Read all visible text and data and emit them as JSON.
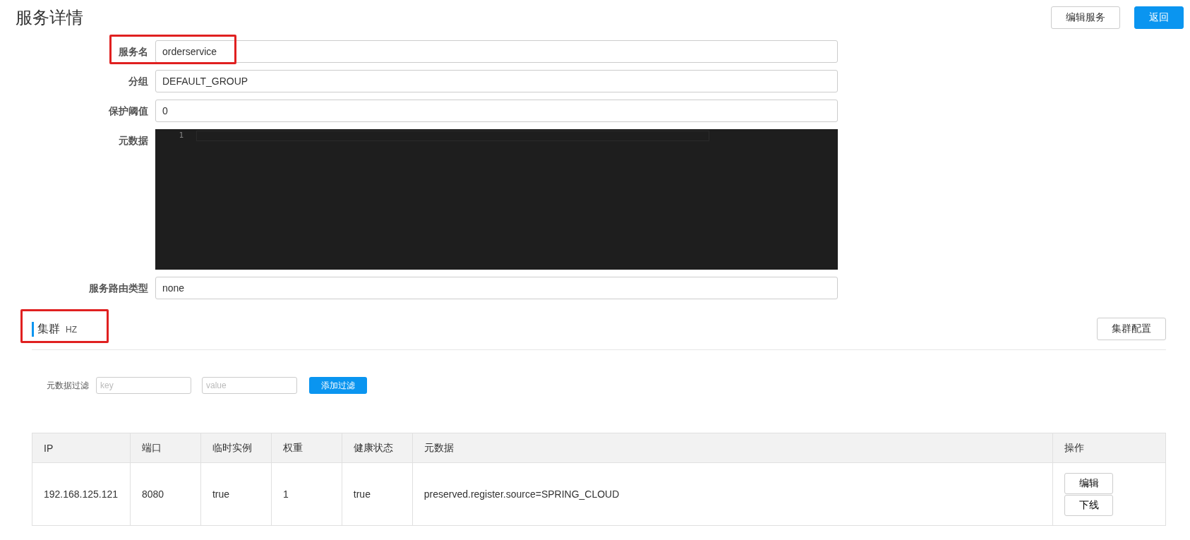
{
  "page": {
    "title": "服务详情",
    "buttons": [
      {
        "label": "编辑服务",
        "kind": "default"
      },
      {
        "label": "返回",
        "kind": "primary"
      }
    ]
  },
  "form": {
    "fields": [
      {
        "kind": "input",
        "label": "服务名",
        "value": "orderservice"
      },
      {
        "kind": "input",
        "label": "分组",
        "value": "DEFAULT_GROUP"
      },
      {
        "kind": "input",
        "label": "保护阈值",
        "value": "0"
      },
      {
        "kind": "editor",
        "label": "元数据",
        "line_numbers": [
          "1"
        ]
      },
      {
        "kind": "input",
        "label": "服务路由类型",
        "value": "none"
      }
    ]
  },
  "cluster": {
    "title": "集群",
    "name": "HZ",
    "config_button": "集群配置",
    "filter": {
      "label": "元数据过滤",
      "key_placeholder": "key",
      "value_placeholder": "value",
      "button": "添加过滤"
    },
    "table": {
      "columns": [
        "IP",
        "端口",
        "临时实例",
        "权重",
        "健康状态",
        "元数据",
        "操作"
      ],
      "rows": [
        {
          "cells": [
            "192.168.125.121",
            "8080",
            "true",
            "1",
            "true",
            "preserved.register.source=SPRING_CLOUD"
          ],
          "actions": [
            "编辑",
            "下线"
          ]
        }
      ]
    }
  }
}
